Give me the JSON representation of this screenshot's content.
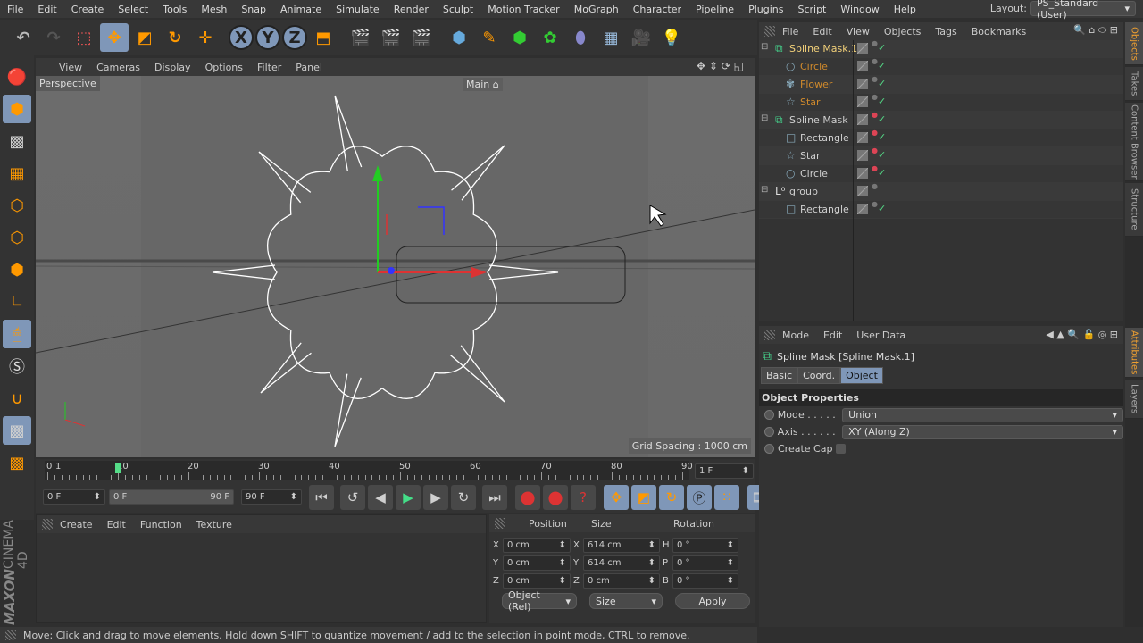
{
  "menu": [
    "File",
    "Edit",
    "Create",
    "Select",
    "Tools",
    "Mesh",
    "Snap",
    "Animate",
    "Simulate",
    "Render",
    "Sculpt",
    "Motion Tracker",
    "MoGraph",
    "Character",
    "Pipeline",
    "Plugins",
    "Script",
    "Window",
    "Help"
  ],
  "layout": {
    "label": "Layout:",
    "value": "PS_Standard (User)"
  },
  "toolbar": {
    "x": "X",
    "y": "Y",
    "z": "Z"
  },
  "viewport": {
    "menu": [
      "View",
      "Cameras",
      "Display",
      "Options",
      "Filter",
      "Panel"
    ],
    "camera": "Perspective",
    "main_label": "Main",
    "grid_spacing": "Grid Spacing : 1000 cm"
  },
  "timeline": {
    "ticks": [
      "0",
      "10",
      "20",
      "30",
      "40",
      "50",
      "60",
      "70",
      "80",
      "90"
    ],
    "current_marker": "1",
    "current_frame": "1 F",
    "start": "0 F",
    "range_start": "0 F",
    "range_end": "90 F",
    "end": "90 F",
    "playhead_fraction": 0.011
  },
  "material_manager": {
    "menu": [
      "Create",
      "Edit",
      "Function",
      "Texture"
    ]
  },
  "coords": {
    "headers": [
      "Position",
      "Size",
      "Rotation"
    ],
    "rows": [
      {
        "a": "X",
        "pos": "0 cm",
        "b": "X",
        "size": "614 cm",
        "c": "H",
        "rot": "0 °"
      },
      {
        "a": "Y",
        "pos": "0 cm",
        "b": "Y",
        "size": "614 cm",
        "c": "P",
        "rot": "0 °"
      },
      {
        "a": "Z",
        "pos": "0 cm",
        "b": "Z",
        "size": "0 cm",
        "c": "B",
        "rot": "0 °"
      }
    ],
    "mode": "Object (Rel)",
    "size_mode": "Size",
    "apply": "Apply"
  },
  "status": "Move: Click and drag to move elements. Hold down SHIFT to quantize movement / add to the selection in point mode, CTRL to remove.",
  "brand": {
    "maxon": "MAXON",
    "cinema": "CINEMA 4D"
  },
  "objects": {
    "menu": [
      "File",
      "Edit",
      "View",
      "Objects",
      "Tags",
      "Bookmarks"
    ],
    "items": [
      {
        "name": "Spline Mask.1",
        "icon": "spline-mask-icon",
        "level": 0,
        "color": "#f4d27a",
        "red": false,
        "check": true
      },
      {
        "name": "Circle",
        "icon": "circle-icon",
        "level": 1,
        "color": "#d08a2c",
        "red": false,
        "check": true
      },
      {
        "name": "Flower",
        "icon": "flower-icon",
        "level": 1,
        "color": "#d08a2c",
        "red": false,
        "check": true
      },
      {
        "name": "Star",
        "icon": "star-icon",
        "level": 1,
        "color": "#d08a2c",
        "red": false,
        "check": true
      },
      {
        "name": "Spline Mask",
        "icon": "spline-mask-icon",
        "level": 0,
        "color": "#d0d0d0",
        "red": true,
        "check": true
      },
      {
        "name": "Rectangle",
        "icon": "rectangle-icon",
        "level": 1,
        "color": "#d0d0d0",
        "red": true,
        "check": true
      },
      {
        "name": "Star",
        "icon": "star-icon",
        "level": 1,
        "color": "#d0d0d0",
        "red": true,
        "check": true
      },
      {
        "name": "Circle",
        "icon": "circle-icon",
        "level": 1,
        "color": "#d0d0d0",
        "red": true,
        "check": true
      },
      {
        "name": "group",
        "icon": "null-icon",
        "level": 0,
        "color": "#d0d0d0",
        "red": false,
        "check": false
      },
      {
        "name": "Rectangle",
        "icon": "rectangle-icon",
        "level": 1,
        "color": "#d0d0d0",
        "red": false,
        "check": true
      }
    ]
  },
  "right_tabs_top": [
    "Objects",
    "Takes",
    "Content Browser",
    "Structure"
  ],
  "right_tabs_bottom": [
    "Attributes",
    "Layers"
  ],
  "attributes": {
    "menu": [
      "Mode",
      "Edit",
      "User Data"
    ],
    "title": "Spline Mask [Spline Mask.1]",
    "tabs": [
      "Basic",
      "Coord.",
      "Object"
    ],
    "section": "Object Properties",
    "mode_label": "Mode . . . . .",
    "mode_value": "Union",
    "axis_label": "Axis . . . . . .",
    "axis_value": "XY (Along Z)",
    "cap_label": "Create Cap"
  },
  "colors": {
    "accent": "#7f97b8",
    "selected_tab": "#f0a030"
  }
}
